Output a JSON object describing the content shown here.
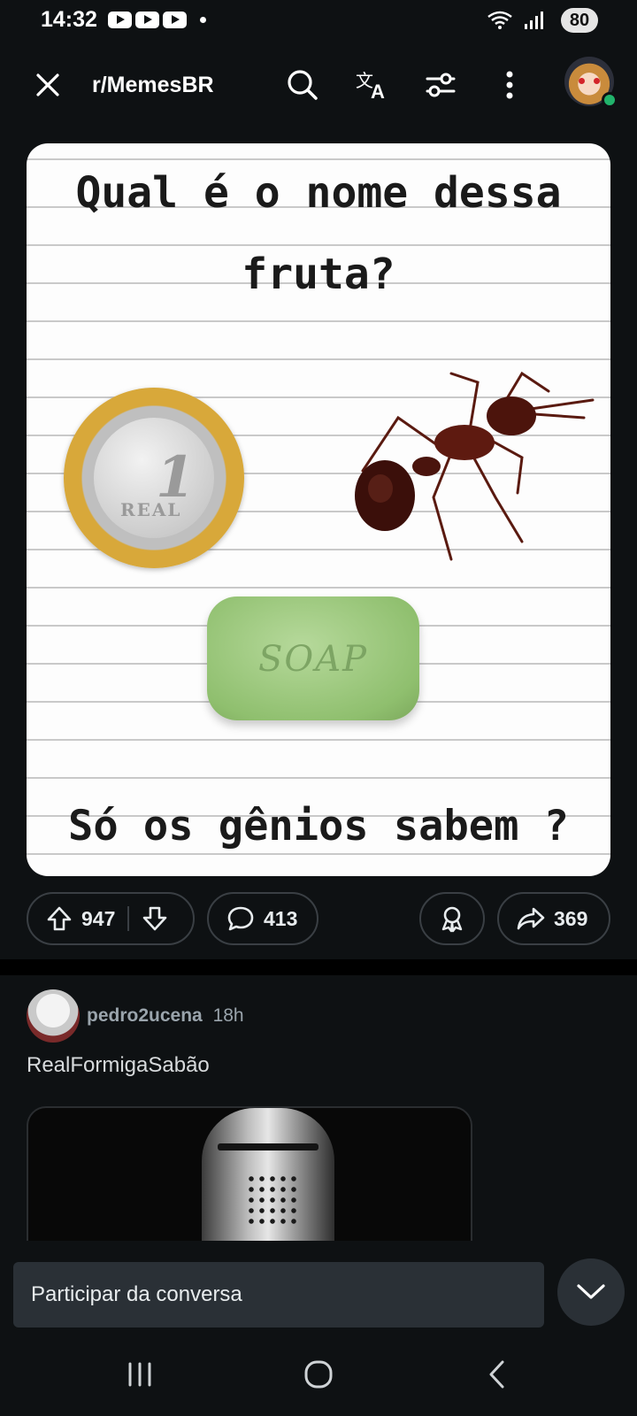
{
  "status_bar": {
    "time": "14:32",
    "notification_icons": [
      "youtube-icon",
      "youtube-icon",
      "youtube-icon"
    ],
    "battery": "80",
    "wifi_label": "5"
  },
  "header": {
    "subreddit": "r/MemesBR",
    "icons": [
      "close-icon",
      "search-icon",
      "translate-icon",
      "filter-icon",
      "more-icon",
      "avatar"
    ]
  },
  "post": {
    "image_text": {
      "title": "Qual é o nome dessa fruta?",
      "bottom": "Só os gênios sabem ?",
      "coin_number": "1",
      "coin_label": "REAL",
      "soap_label": "SOAP"
    },
    "actions": {
      "upvotes": "947",
      "comments": "413",
      "shares": "369"
    }
  },
  "next_post": {
    "author": "pedro2ucena",
    "time": "18h",
    "title": "RealFormigaSabão"
  },
  "comment_bar": {
    "placeholder": "Participar da conversa"
  },
  "colors": {
    "background": "#0e1113",
    "pill_border": "#3a3f44",
    "input_bg": "#2a3036",
    "online": "#21b36b"
  }
}
